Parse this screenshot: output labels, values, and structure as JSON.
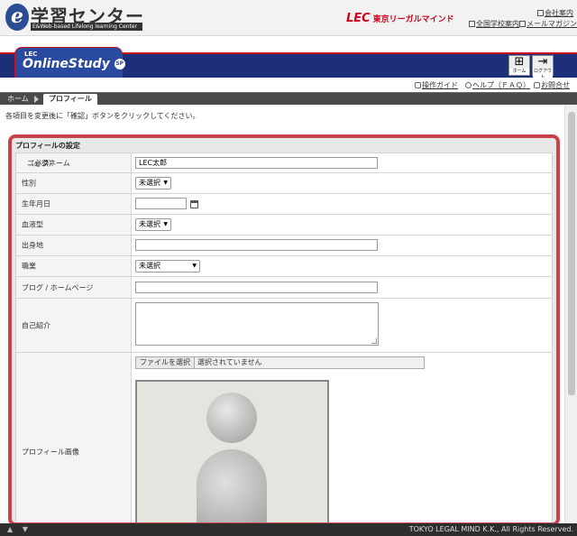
{
  "header": {
    "logo_letter": "e",
    "site_title": "学習センター",
    "site_subtitle": "E&Web-based Lifelong learning Center",
    "brand_mark": "LEC",
    "brand_name": "東京リーガルマインド",
    "company_link": "会社案内",
    "schools_link": "全国学校案内",
    "magazine_link": "メールマガジン"
  },
  "brandbar": {
    "lec": "LEC",
    "name": "OnlineStudy",
    "badge": "SP",
    "home_label": "ホーム",
    "logout_label": "ログアウト"
  },
  "sublinks": {
    "guide": "操作ガイド",
    "faq": "ヘルプ（ＦＡＱ）",
    "contact": "お問合せ"
  },
  "breadcrumb": {
    "home": "ホーム",
    "current": "プロフィール"
  },
  "instruction": "各項目を変更後に「確認」ボタンをクリックしてください。",
  "form": {
    "section_title": "プロフィールの設定",
    "nickname_label": "ニックネーム",
    "required_mark": "（必須）",
    "nickname_value": "LEC太郎",
    "gender_label": "性別",
    "gender_value": "未選択",
    "birthday_label": "生年月日",
    "birthday_value": "",
    "blood_label": "血液型",
    "blood_value": "未選択",
    "hometown_label": "出身地",
    "hometown_value": "",
    "job_label": "職業",
    "job_value": "未選択",
    "blog_label": "ブログ / ホームページ",
    "blog_value": "",
    "intro_label": "自己紹介",
    "image_label": "プロフィール画像",
    "file_button": "ファイルを選択",
    "file_status": "選択されていません"
  },
  "footer": {
    "arrows": "▲ ▼",
    "copyright": "TOKYO LEGAL MIND K.K., All Rights Reserved."
  }
}
